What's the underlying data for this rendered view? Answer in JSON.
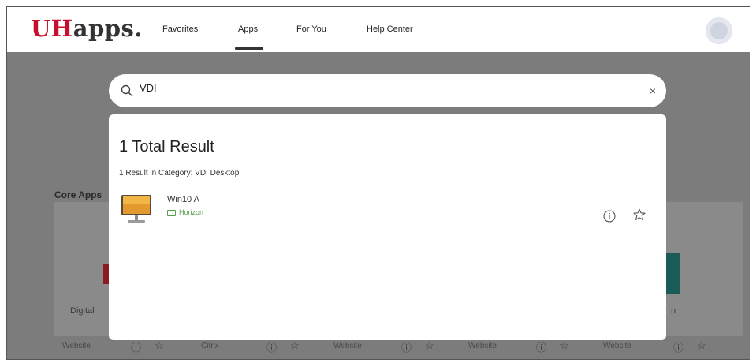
{
  "header": {
    "logo_prefix": "UH",
    "logo_suffix": "apps.",
    "nav": [
      "Favorites",
      "Apps",
      "For You",
      "Help Center"
    ],
    "active_nav": "Apps"
  },
  "search": {
    "value": "VDI",
    "clear_symbol": "×"
  },
  "results": {
    "title": "1 Total Result",
    "category_line": "1 Result in Category: VDI Desktop",
    "items": [
      {
        "name": "Win10 A",
        "tag": "Horizon",
        "icon": "desktop-monitor-icon"
      }
    ]
  },
  "background": {
    "section_label": "Core Apps",
    "partial_labels": [
      "Digital",
      "n"
    ],
    "footer_items": [
      "Website",
      "Citrix",
      "Website",
      "Website",
      "Website"
    ]
  },
  "colors": {
    "brand_red": "#c8102e",
    "overlay": "#7c7c7c",
    "tag_green": "#55a14a"
  }
}
